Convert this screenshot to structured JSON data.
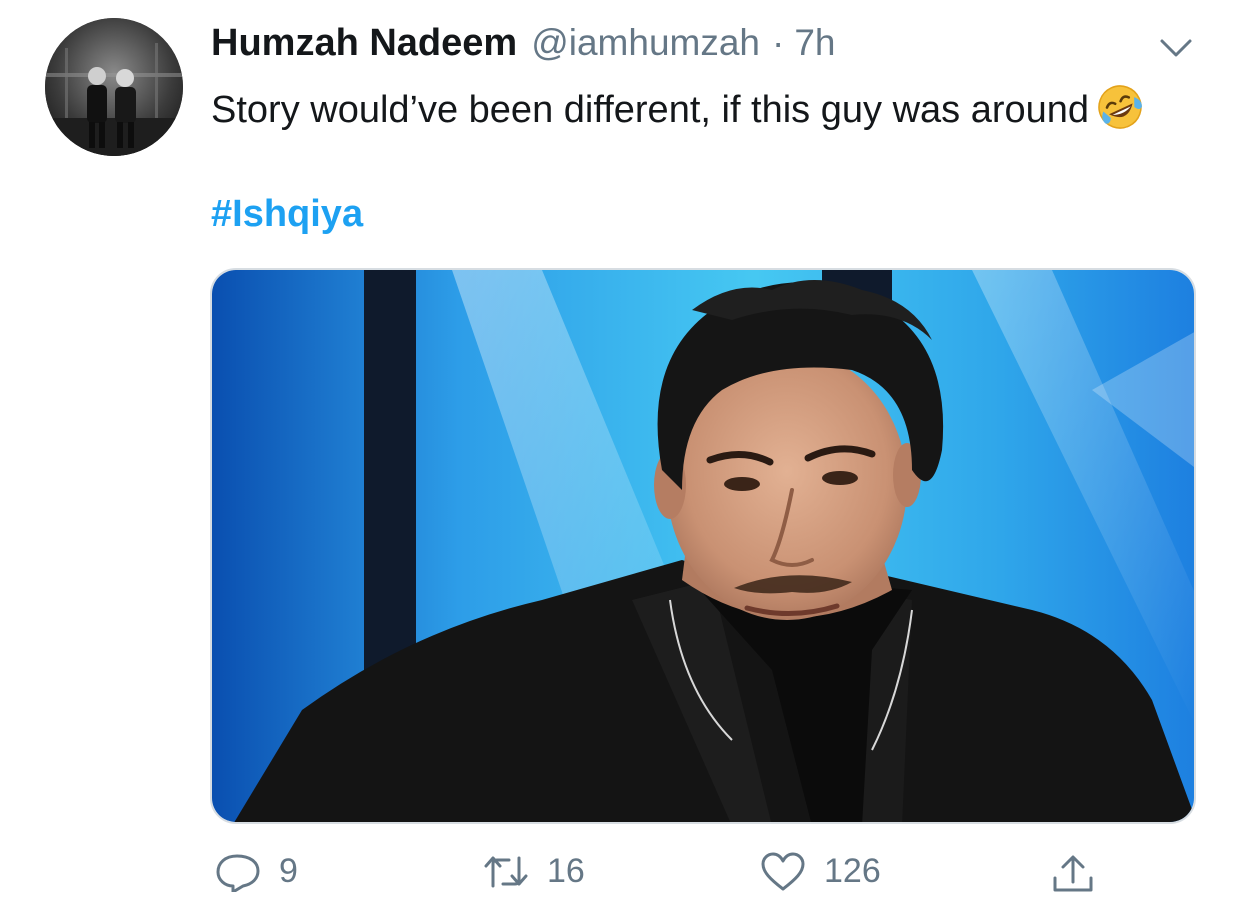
{
  "tweet": {
    "display_name": "Humzah Nadeem",
    "handle": "@iamhumzah",
    "separator": "·",
    "time": "7h",
    "text": "Story would’ve been different, if this guy was around",
    "emoji": "rolling-on-the-floor-laughing",
    "hashtag": "#Ishqiya"
  },
  "actions": {
    "reply_count": "9",
    "retweet_count": "16",
    "like_count": "126"
  },
  "icons": {
    "reply": "speech-bubble-icon",
    "retweet": "retweet-arrows-icon",
    "like": "heart-icon",
    "share": "share-arrow-icon",
    "more": "chevron-down-icon"
  },
  "colors": {
    "link": "#1da1f2",
    "muted": "#657786",
    "text": "#14171a"
  }
}
